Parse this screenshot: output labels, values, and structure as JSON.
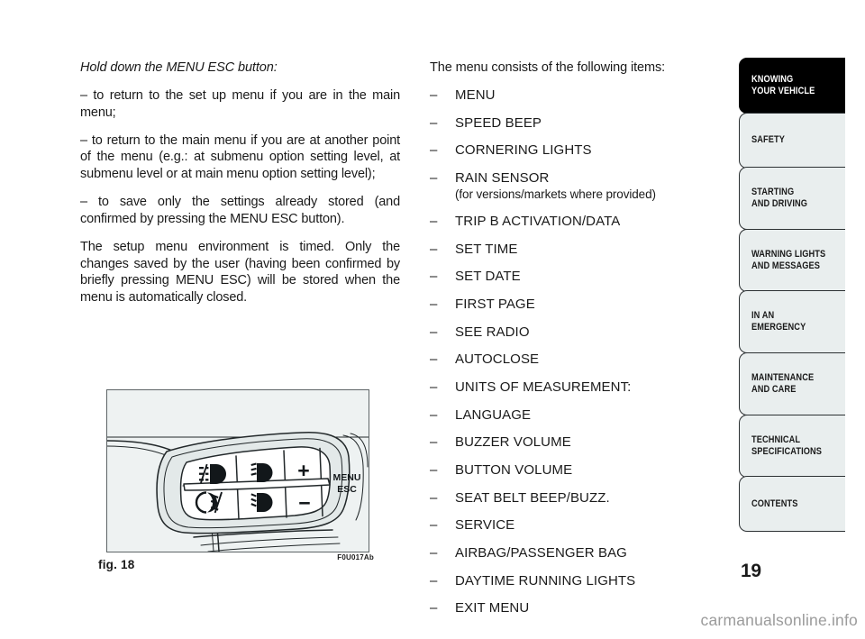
{
  "document": {
    "page_number": "19",
    "watermark": "carmanualsonline.info"
  },
  "left_column": {
    "lead": "Hold down the MENU ESC button:",
    "paragraphs": [
      "– to return to the set up menu if you are in the main menu;",
      "– to return to the main menu if you are at another point of the menu (e.g.: at submenu option setting level, at submenu level or at main menu option setting level);",
      "– to save only the settings already stored (and confirmed by pressing the MENU ESC button).",
      "The setup menu environment is timed. Only the changes saved by the user (having been confirmed by briefly pressing MENU ESC) will be stored when the menu is automatically closed."
    ]
  },
  "right_column": {
    "intro": "The menu consists of the following items:",
    "dash": "–",
    "items": [
      {
        "label": "MENU"
      },
      {
        "label": "SPEED BEEP"
      },
      {
        "label": "CORNERING LIGHTS"
      },
      {
        "label": "RAIN SENSOR",
        "note": "(for versions/markets where provided)"
      },
      {
        "label": "TRIP B ACTIVATION/DATA"
      },
      {
        "label": "SET TIME"
      },
      {
        "label": "SET DATE"
      },
      {
        "label": "FIRST PAGE"
      },
      {
        "label": "SEE RADIO"
      },
      {
        "label": "AUTOCLOSE"
      },
      {
        "label": "UNITS OF MEASUREMENT:"
      },
      {
        "label": "LANGUAGE"
      },
      {
        "label": "BUZZER VOLUME"
      },
      {
        "label": "BUTTON VOLUME"
      },
      {
        "label": "SEAT BELT BEEP/BUZZ."
      },
      {
        "label": "SERVICE"
      },
      {
        "label": "AIRBAG/PASSENGER BAG"
      },
      {
        "label": "DAYTIME RUNNING LIGHTS"
      },
      {
        "label": "EXIT MENU"
      }
    ]
  },
  "figure": {
    "caption": "fig. 18",
    "code": "F0U017Ab",
    "buttons": {
      "plus": "+",
      "minus": "−",
      "menu_line1": "MENU",
      "menu_line2": "ESC"
    }
  },
  "sidebar": {
    "tabs": [
      {
        "label": "KNOWING\nYOUR VEHICLE",
        "active": true
      },
      {
        "label": "SAFETY",
        "active": false
      },
      {
        "label": "STARTING\nAND DRIVING",
        "active": false
      },
      {
        "label": "WARNING LIGHTS\nAND MESSAGES",
        "active": false
      },
      {
        "label": "IN AN\nEMERGENCY",
        "active": false
      },
      {
        "label": "MAINTENANCE\nAND CARE",
        "active": false
      },
      {
        "label": "TECHNICAL\nSPECIFICATIONS",
        "active": false
      },
      {
        "label": "CONTENTS",
        "active": false
      }
    ]
  },
  "colors": {
    "tab_active_bg": "#000000",
    "tab_inactive_bg": "#e9eeee",
    "tab_border": "#2c3133",
    "watermark": "#9b9b9b",
    "text": "#1a1a1a"
  }
}
